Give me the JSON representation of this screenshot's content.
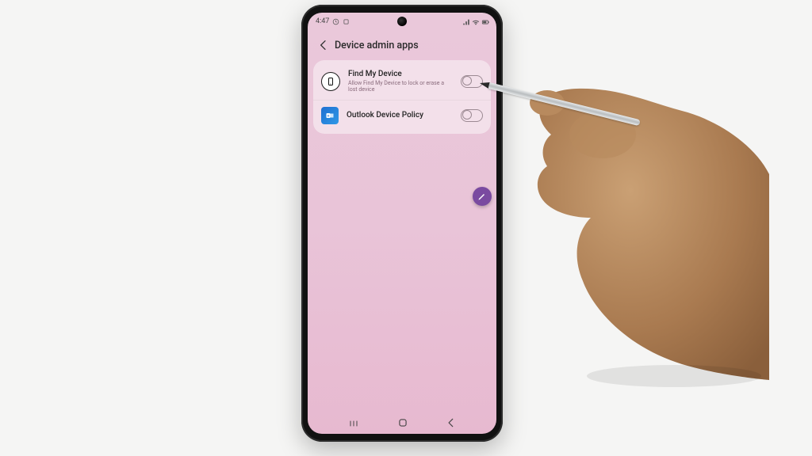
{
  "status": {
    "time": "4:47",
    "left_icons": [
      "clock-icon",
      "notification-icon"
    ],
    "right_icons": [
      "signal-icon",
      "wifi-icon",
      "battery-icon"
    ]
  },
  "header": {
    "title": "Device admin apps"
  },
  "rows": [
    {
      "title": "Find My Device",
      "subtitle": "Allow Find My Device to lock or erase a lost device",
      "icon": "find-my-device-icon",
      "toggle": false
    },
    {
      "title": "Outlook Device Policy",
      "subtitle": "",
      "icon": "outlook-icon",
      "toggle": false
    }
  ],
  "fab": {
    "label": "edit"
  },
  "nav": {
    "recent": "|||",
    "home": "○",
    "back": "‹"
  }
}
